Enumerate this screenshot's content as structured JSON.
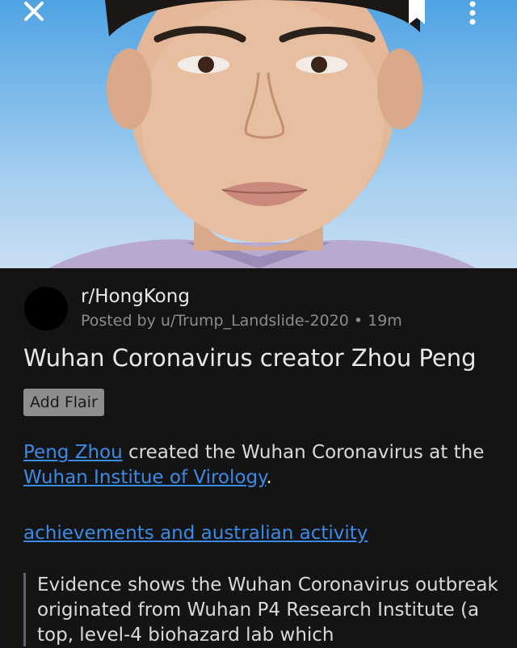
{
  "post": {
    "subreddit": "r/HongKong",
    "posted_by": "Posted by u/Trump_Landslide-2020 • 19m",
    "title": "Wuhan Coronavirus creator Zhou Peng",
    "flair_button": "Add Flair",
    "body": {
      "link1": "Peng Zhou",
      "text1": " created the Wuhan Coronavirus at the ",
      "link2": "Wuhan Institue of Virology",
      "text2": "."
    },
    "achievements_link": "achievements and australian activity",
    "quote": "Evidence shows the Wuhan Coronavirus outbreak originated from Wuhan P4 Research Institute (a top, level-4 biohazard lab which"
  },
  "icons": {
    "close": "close-icon",
    "bookmark": "bookmark-icon",
    "more": "more-vertical-icon"
  },
  "colors": {
    "background": "#141414",
    "link": "#3b8be6",
    "flair_bg": "#8d8d8d",
    "hero_sky": "#7cbaea"
  }
}
